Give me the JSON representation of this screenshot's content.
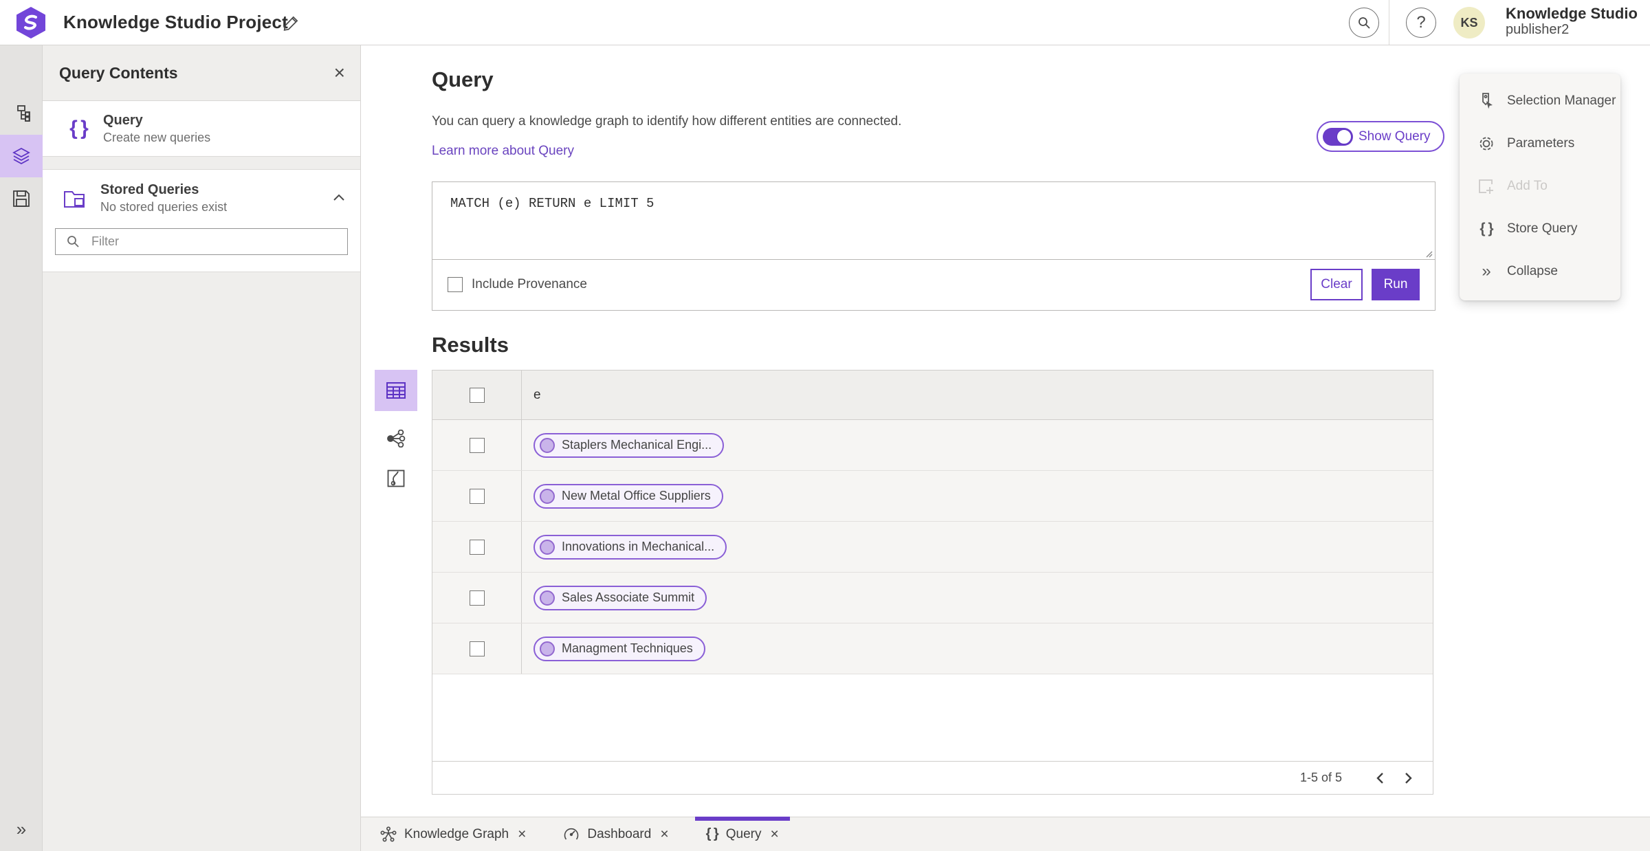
{
  "header": {
    "title": "Knowledge Studio Project",
    "user": {
      "initials": "KS",
      "app_name": "Knowledge Studio",
      "username": "publisher2"
    }
  },
  "contents_panel": {
    "title": "Query Contents",
    "query_item": {
      "title": "Query",
      "subtitle": "Create new queries"
    },
    "stored_item": {
      "title": "Stored Queries",
      "subtitle": "No stored queries exist"
    },
    "filter_placeholder": "Filter"
  },
  "query_section": {
    "title": "Query",
    "description": "You can query a knowledge graph to identify how different entities are connected.",
    "learn_more": "Learn more about Query",
    "show_query_label": "Show Query",
    "show_query_enabled": true,
    "query_text": "MATCH (e) RETURN e LIMIT 5",
    "include_provenance_label": "Include Provenance",
    "clear_label": "Clear",
    "run_label": "Run"
  },
  "results": {
    "title": "Results",
    "column_header": "e",
    "rows": [
      "Staplers Mechanical Engi...",
      "New Metal Office Suppliers",
      "Innovations in Mechanical...",
      "Sales Associate Summit",
      "Managment Techniques"
    ],
    "pagination": "1-5 of 5"
  },
  "context_menu": {
    "items": [
      {
        "label": "Selection Manager",
        "disabled": false
      },
      {
        "label": "Parameters",
        "disabled": false
      },
      {
        "label": "Add To",
        "disabled": true
      },
      {
        "label": "Store Query",
        "disabled": false
      },
      {
        "label": "Collapse",
        "disabled": false
      }
    ]
  },
  "tabs": [
    {
      "label": "Knowledge Graph",
      "active": false
    },
    {
      "label": "Dashboard",
      "active": false
    },
    {
      "label": "Query",
      "active": true
    }
  ],
  "icons": {
    "close": "×",
    "braces": "{ }",
    "collapse_chevrons": "»",
    "help": "?",
    "expand_rail": "»"
  },
  "colors": {
    "primary_purple": "#6a3dc8",
    "selected_light_purple": "#d7c3f3",
    "pill_bg": "#f6f2fc",
    "pill_border": "#8a5fd6",
    "avatar_bg": "#efecc4",
    "panel_bg": "#efeeec",
    "table_header_bg": "#efeeec",
    "row_bg": "#f6f5f3"
  }
}
